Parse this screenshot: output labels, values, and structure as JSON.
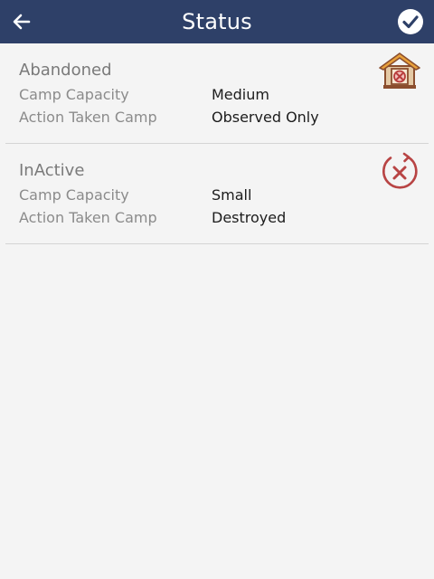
{
  "header": {
    "title": "Status"
  },
  "cards": [
    {
      "title": "Abandoned",
      "icon": "abandoned-house-icon",
      "rows": [
        {
          "label": "Camp Capacity",
          "value": "Medium"
        },
        {
          "label": "Action Taken Camp",
          "value": "Observed Only"
        }
      ]
    },
    {
      "title": "InActive",
      "icon": "inactive-cross-circle-icon",
      "rows": [
        {
          "label": "Camp Capacity",
          "value": "Small"
        },
        {
          "label": "Action Taken Camp",
          "value": "Destroyed"
        }
      ]
    }
  ],
  "colors": {
    "appbar": "#2e4068",
    "background": "#f4f4f4"
  }
}
